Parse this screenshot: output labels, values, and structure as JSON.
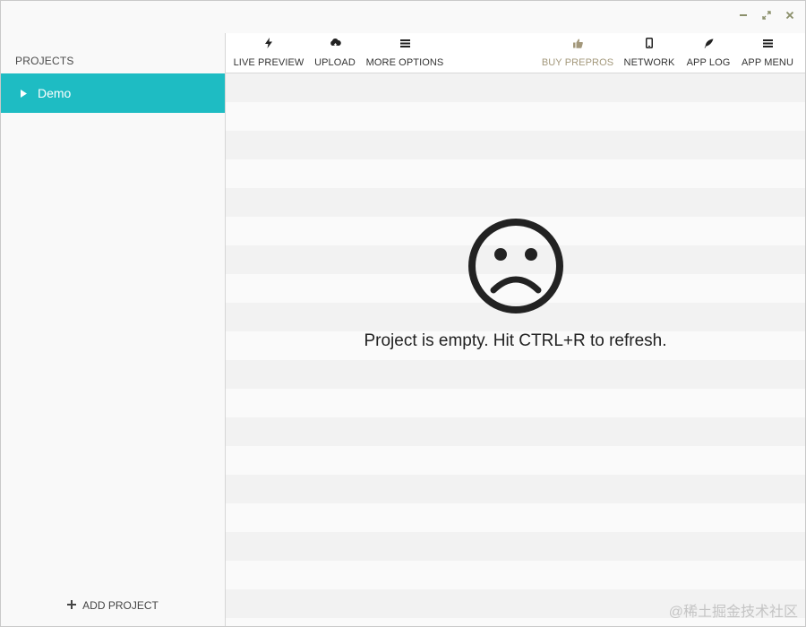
{
  "window": {
    "controls": {
      "minimize_icon": "minimize-icon",
      "maximize_icon": "maximize-icon",
      "close_icon": "close-icon"
    }
  },
  "sidebar": {
    "header": "PROJECTS",
    "projects": [
      {
        "label": "Demo",
        "icon": "caret-right-icon",
        "selected": true
      }
    ],
    "add_project": {
      "label": "ADD PROJECT",
      "icon": "plus-icon"
    }
  },
  "toolbar": {
    "left": [
      {
        "label": "LIVE PREVIEW",
        "icon": "lightning-icon"
      },
      {
        "label": "UPLOAD",
        "icon": "cloud-upload-icon"
      },
      {
        "label": "MORE OPTIONS",
        "icon": "menu-icon"
      }
    ],
    "right": [
      {
        "label": "BUY PREPROS",
        "icon": "thumbs-up-icon"
      },
      {
        "label": "NETWORK",
        "icon": "mobile-icon"
      },
      {
        "label": "APP LOG",
        "icon": "feather-icon"
      },
      {
        "label": "APP MENU",
        "icon": "menu-icon"
      }
    ]
  },
  "main": {
    "empty_icon": "sad-face-icon",
    "empty_message": "Project is empty. Hit CTRL+R to refresh."
  },
  "watermark": "@稀土掘金技术社区",
  "colors": {
    "accent": "#1ebcc3",
    "buy_label": "#a3987b",
    "stripe_dark": "#f2f2f2",
    "stripe_light": "#fafafa"
  }
}
